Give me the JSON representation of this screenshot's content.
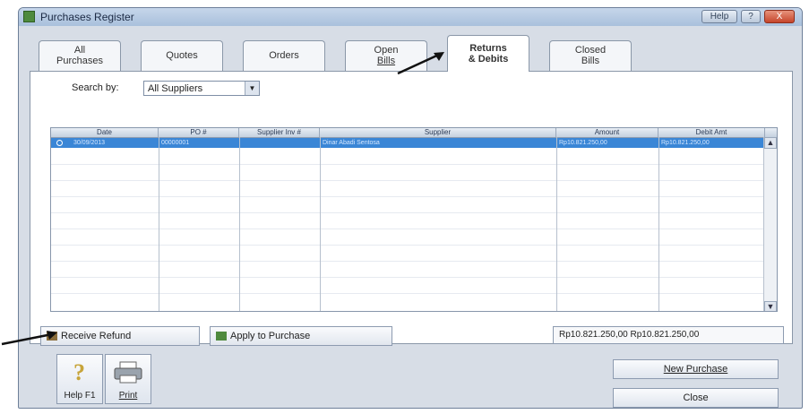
{
  "window": {
    "title": "Purchases Register",
    "buttons": [
      "Help",
      "?",
      "X"
    ]
  },
  "tabs": [
    {
      "lines": [
        "All",
        "Purchases"
      ]
    },
    {
      "lines": [
        "Quotes"
      ]
    },
    {
      "lines": [
        "Orders"
      ]
    },
    {
      "lines": [
        "Open",
        "Bills"
      ]
    },
    {
      "lines": [
        "Returns",
        "& Debits"
      ],
      "active": true
    },
    {
      "lines": [
        "Closed",
        "Bills"
      ]
    }
  ],
  "search": {
    "label": "Search by:",
    "value": "All Suppliers"
  },
  "table": {
    "columns": [
      "Date",
      "PO #",
      "Supplier Inv #",
      "Supplier",
      "Amount",
      "Debit Amt"
    ],
    "rows": [
      {
        "date": "30/09/2013",
        "po": "00000001",
        "supplier_inv": "",
        "supplier": "Dinar Abadi Sentosa",
        "amount": "Rp10.821.250,00",
        "debit_amt": "Rp10.821.250,00"
      }
    ]
  },
  "actions": {
    "receive_refund": "Receive Refund",
    "apply_to_purchase": "Apply to Purchase"
  },
  "totals": {
    "amount": "Rp10.821.250,00",
    "debit_amt": "Rp10.821.250,00"
  },
  "toolbar": {
    "help": "Help F1",
    "print": "Print"
  },
  "buttons": {
    "new_purchase": "New Purchase",
    "close": "Close"
  },
  "colors": {
    "selection": "#3a86d6",
    "frame": "#d7dde6"
  }
}
